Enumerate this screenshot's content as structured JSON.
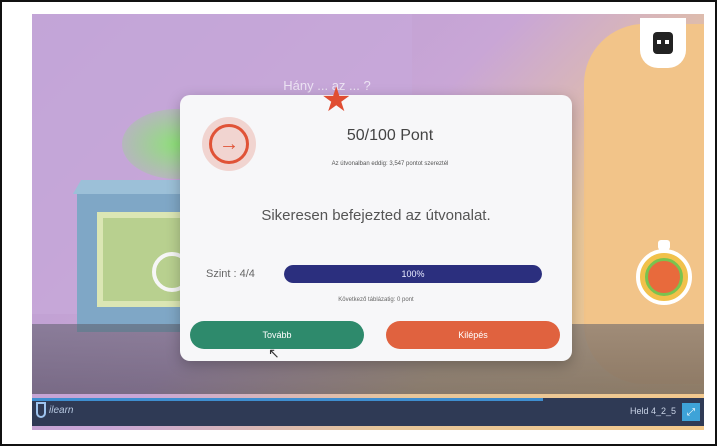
{
  "scene": {
    "question": "Hány ... az ... ?"
  },
  "modal": {
    "star_icon": "star-icon",
    "route_icon": "route-icon",
    "points_title": "50/100 Pont",
    "points_subtitle": "Az útvonalban eddig: 3,547 pontot szereztél",
    "success_message": "Sikeresen befejezted az útvonalat.",
    "level_label": "Szint : 4/4",
    "progress_percent": 100,
    "progress_text": "100%",
    "next_level_text": "Következő táblázatig: 0 pont",
    "next_button": "Tovább",
    "exit_button": "Kilépés"
  },
  "bottom_bar": {
    "logo_text": "ilearn",
    "version": "Held 4_2_5",
    "progress_fraction": 0.76
  },
  "colors": {
    "accent_red": "#e05337",
    "progress_blue": "#2b2f7e",
    "next_green": "#2e8a6c",
    "exit_orange": "#e0623f"
  }
}
